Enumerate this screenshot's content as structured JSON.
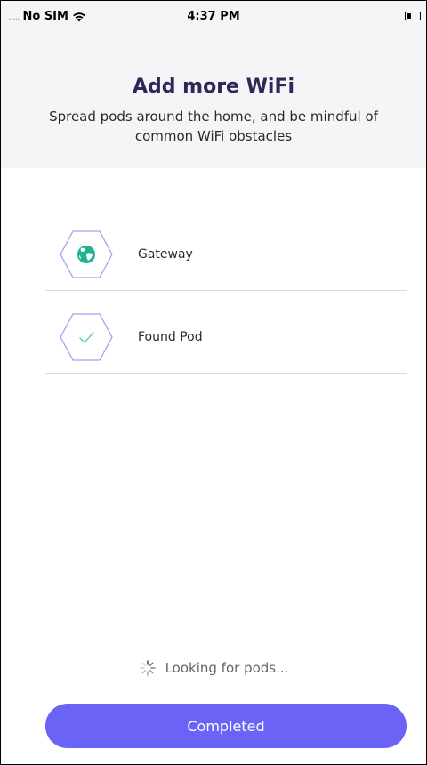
{
  "status_bar": {
    "signal": ".....",
    "carrier": "No SIM",
    "time": "4:37 PM"
  },
  "header": {
    "title": "Add more WiFi",
    "subtitle": "Spread pods around the home, and be mindful of common WiFi obstacles"
  },
  "pods": [
    {
      "label": "Gateway",
      "icon": "globe-icon"
    },
    {
      "label": "Found Pod",
      "icon": "checkmark-icon"
    }
  ],
  "status": {
    "looking_text": "Looking for pods..."
  },
  "actions": {
    "completed_label": "Completed"
  },
  "colors": {
    "accent": "#6b63f5",
    "title": "#2e2858",
    "header_bg": "#f5f5f7",
    "hex_stroke": "#a99cf0",
    "globe": "#1fb48e",
    "check": "#5ccfb0"
  }
}
